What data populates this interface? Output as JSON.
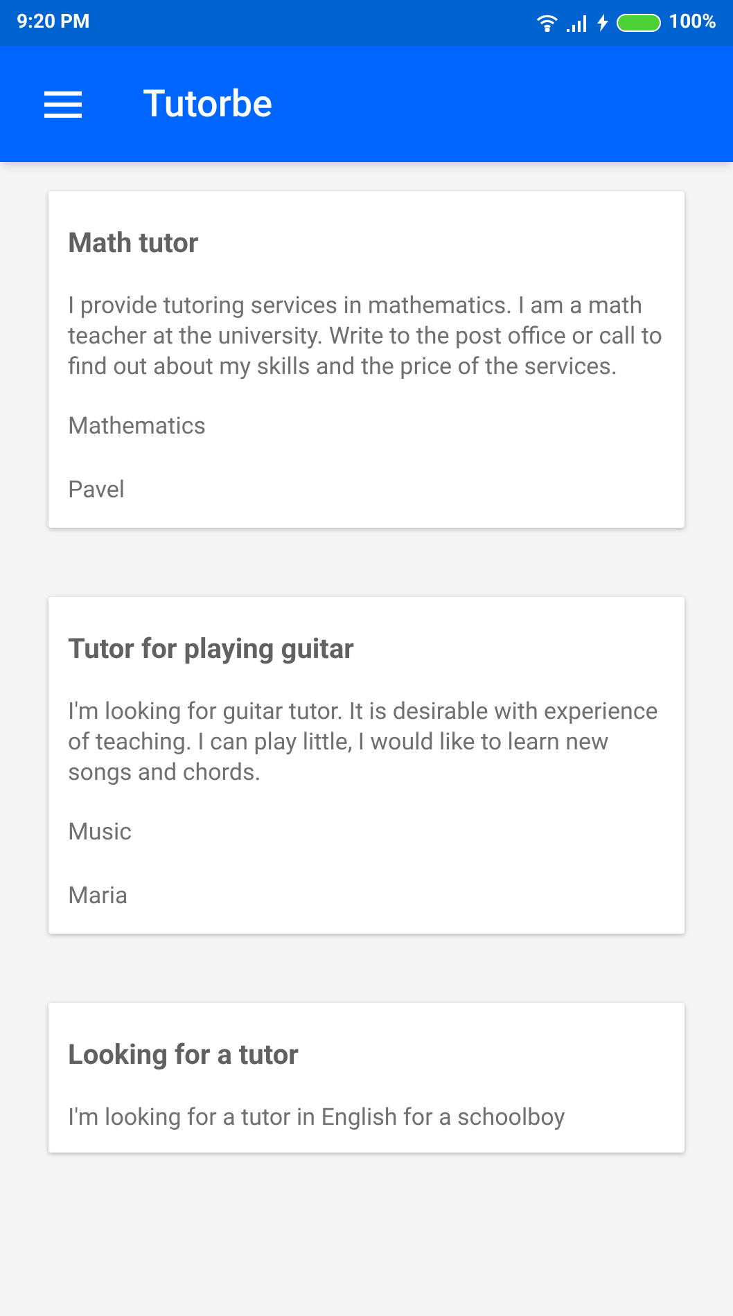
{
  "status_bar": {
    "time": "9:20 PM",
    "battery": "100%"
  },
  "app_bar": {
    "title": "Tutorbe"
  },
  "posts": [
    {
      "title": "Math tutor",
      "description": "I provide tutoring services in mathematics. I am a math teacher at the university. Write to the post office or call to find out about my skills and the price of the services.",
      "subject": "Mathematics",
      "author": "Pavel"
    },
    {
      "title": "Tutor for playing guitar",
      "description": "I'm looking for guitar tutor. It is desirable with experience of teaching. I can play little, I would like to learn new songs and chords.",
      "subject": "Music",
      "author": "Maria"
    },
    {
      "title": "Looking for a tutor",
      "description": "I'm looking for a tutor in English for a schoolboy"
    }
  ]
}
